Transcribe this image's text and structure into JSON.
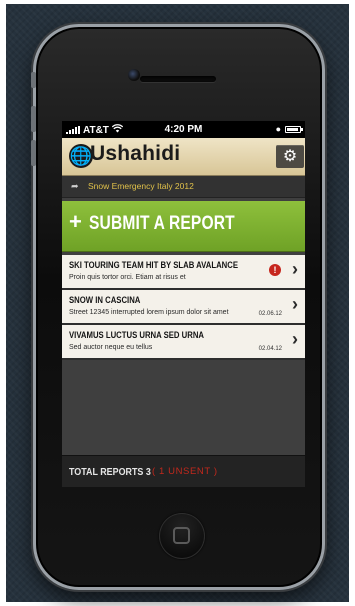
{
  "status_bar": {
    "carrier": "AT&T",
    "time": "4:20 PM"
  },
  "app": {
    "name": "Ushahidi"
  },
  "deployment": {
    "name": "Snow Emergency Italy 2012"
  },
  "submit": {
    "plus": "+",
    "label": "SUBMIT A REPORT"
  },
  "reports": [
    {
      "title": "SKI TOURING TEAM HIT BY SLAB AVALANCE",
      "description": "Proin quis tortor orci. Etiam at risus et",
      "date": "",
      "alert": "!"
    },
    {
      "title": "SNOW IN CASCINA",
      "description": "Street 12345 interrupted lorem ipsum dolor sit amet",
      "date": "02.06.12"
    },
    {
      "title": "VIVAMUS LUCTUS URNA SED URNA",
      "description": "Sed auctor neque eu tellus",
      "date": "02.04.12"
    }
  ],
  "footer": {
    "label": "TOTAL REPORTS 3",
    "unsent": "( 1 UNSENT )"
  },
  "colors": {
    "accent_green": "#7db130",
    "alert_red": "#c6261d",
    "header_tan": "#d8c697"
  },
  "icons": [
    "wifi-icon",
    "lock-icon",
    "battery-icon",
    "globe-icon",
    "gear-icon",
    "arrow-icon",
    "chevron-right-icon",
    "alert-icon"
  ]
}
